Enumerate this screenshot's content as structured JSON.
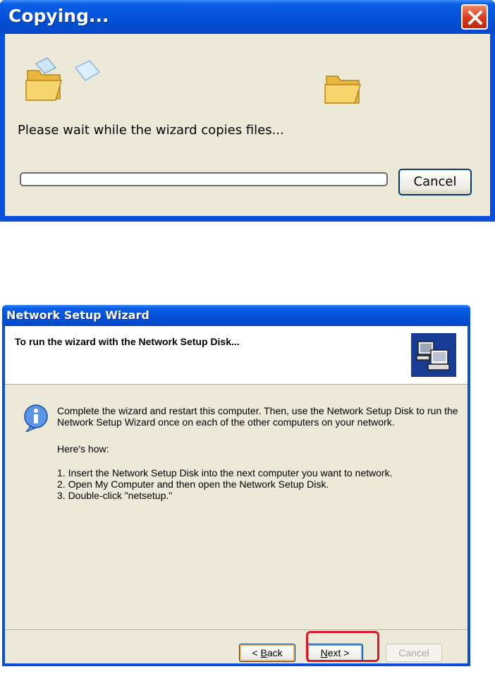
{
  "copy_dialog": {
    "title": "Copying...",
    "message": "Please wait while the wizard copies files...",
    "progress": 0,
    "cancel_label": "Cancel"
  },
  "wizard": {
    "title": "Network Setup Wizard",
    "heading": "To run the wizard with the Network Setup Disk...",
    "paragraph": "Complete the wizard and restart this computer. Then, use the Network Setup Disk to run the Network Setup Wizard once on each of the other computers on your network.",
    "howto": "Here's how:",
    "steps": [
      "1.  Insert the Network Setup Disk into the next computer you want to network.",
      "2.  Open My Computer and then open the Network Setup Disk.",
      "3.  Double-click \"netsetup.\""
    ],
    "buttons": {
      "back_arrow": "< ",
      "back_accel": "B",
      "back_rest": "ack",
      "next_accel": "N",
      "next_rest": "ext >",
      "cancel": "Cancel"
    }
  },
  "icons": {
    "close": "close-icon",
    "folder_source": "folder-open-icon",
    "flying_paper": "paper-icon",
    "folder_dest": "folder-icon",
    "info": "info-icon",
    "wizard_logo": "network-computers-icon"
  },
  "colors": {
    "title_bar": "#0451d6",
    "dialog_face": "#ece9d8",
    "close_button": "#d6391a",
    "highlight": "#d71b2a"
  }
}
